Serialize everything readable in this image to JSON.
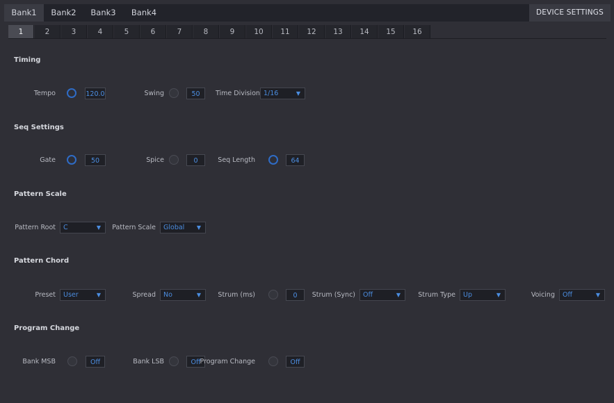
{
  "banks": [
    "Bank1",
    "Bank2",
    "Bank3",
    "Bank4"
  ],
  "device_settings": "DEVICE SETTINGS",
  "numbers": [
    "1",
    "2",
    "3",
    "4",
    "5",
    "6",
    "7",
    "8",
    "9",
    "10",
    "11",
    "12",
    "13",
    "14",
    "15",
    "16"
  ],
  "timing": {
    "title": "Timing",
    "tempo_label": "Tempo",
    "tempo_value": "120.0",
    "swing_label": "Swing",
    "swing_value": "50",
    "timediv_label": "Time Division",
    "timediv_value": "1/16"
  },
  "seq": {
    "title": "Seq Settings",
    "gate_label": "Gate",
    "gate_value": "50",
    "spice_label": "Spice",
    "spice_value": "0",
    "length_label": "Seq Length",
    "length_value": "64"
  },
  "scale": {
    "title": "Pattern Scale",
    "root_label": "Pattern Root",
    "root_value": "C",
    "scale_label": "Pattern Scale",
    "scale_value": "Global"
  },
  "chord": {
    "title": "Pattern Chord",
    "preset_label": "Preset",
    "preset_value": "User",
    "spread_label": "Spread",
    "spread_value": "No",
    "strum_ms_label": "Strum (ms)",
    "strum_ms_value": "0",
    "strum_sync_label": "Strum (Sync)",
    "strum_sync_value": "Off",
    "strum_type_label": "Strum Type",
    "strum_type_value": "Up",
    "voicing_label": "Voicing",
    "voicing_value": "Off"
  },
  "program": {
    "title": "Program Change",
    "msb_label": "Bank MSB",
    "msb_value": "Off",
    "lsb_label": "Bank LSB",
    "lsb_value": "Off",
    "pc_label": "Program Change",
    "pc_value": "Off"
  },
  "icons": {
    "dropdown": "▼"
  },
  "colors": {
    "accent": "#4b8de0",
    "background": "#2f2f36",
    "tabbar": "#22232a"
  }
}
